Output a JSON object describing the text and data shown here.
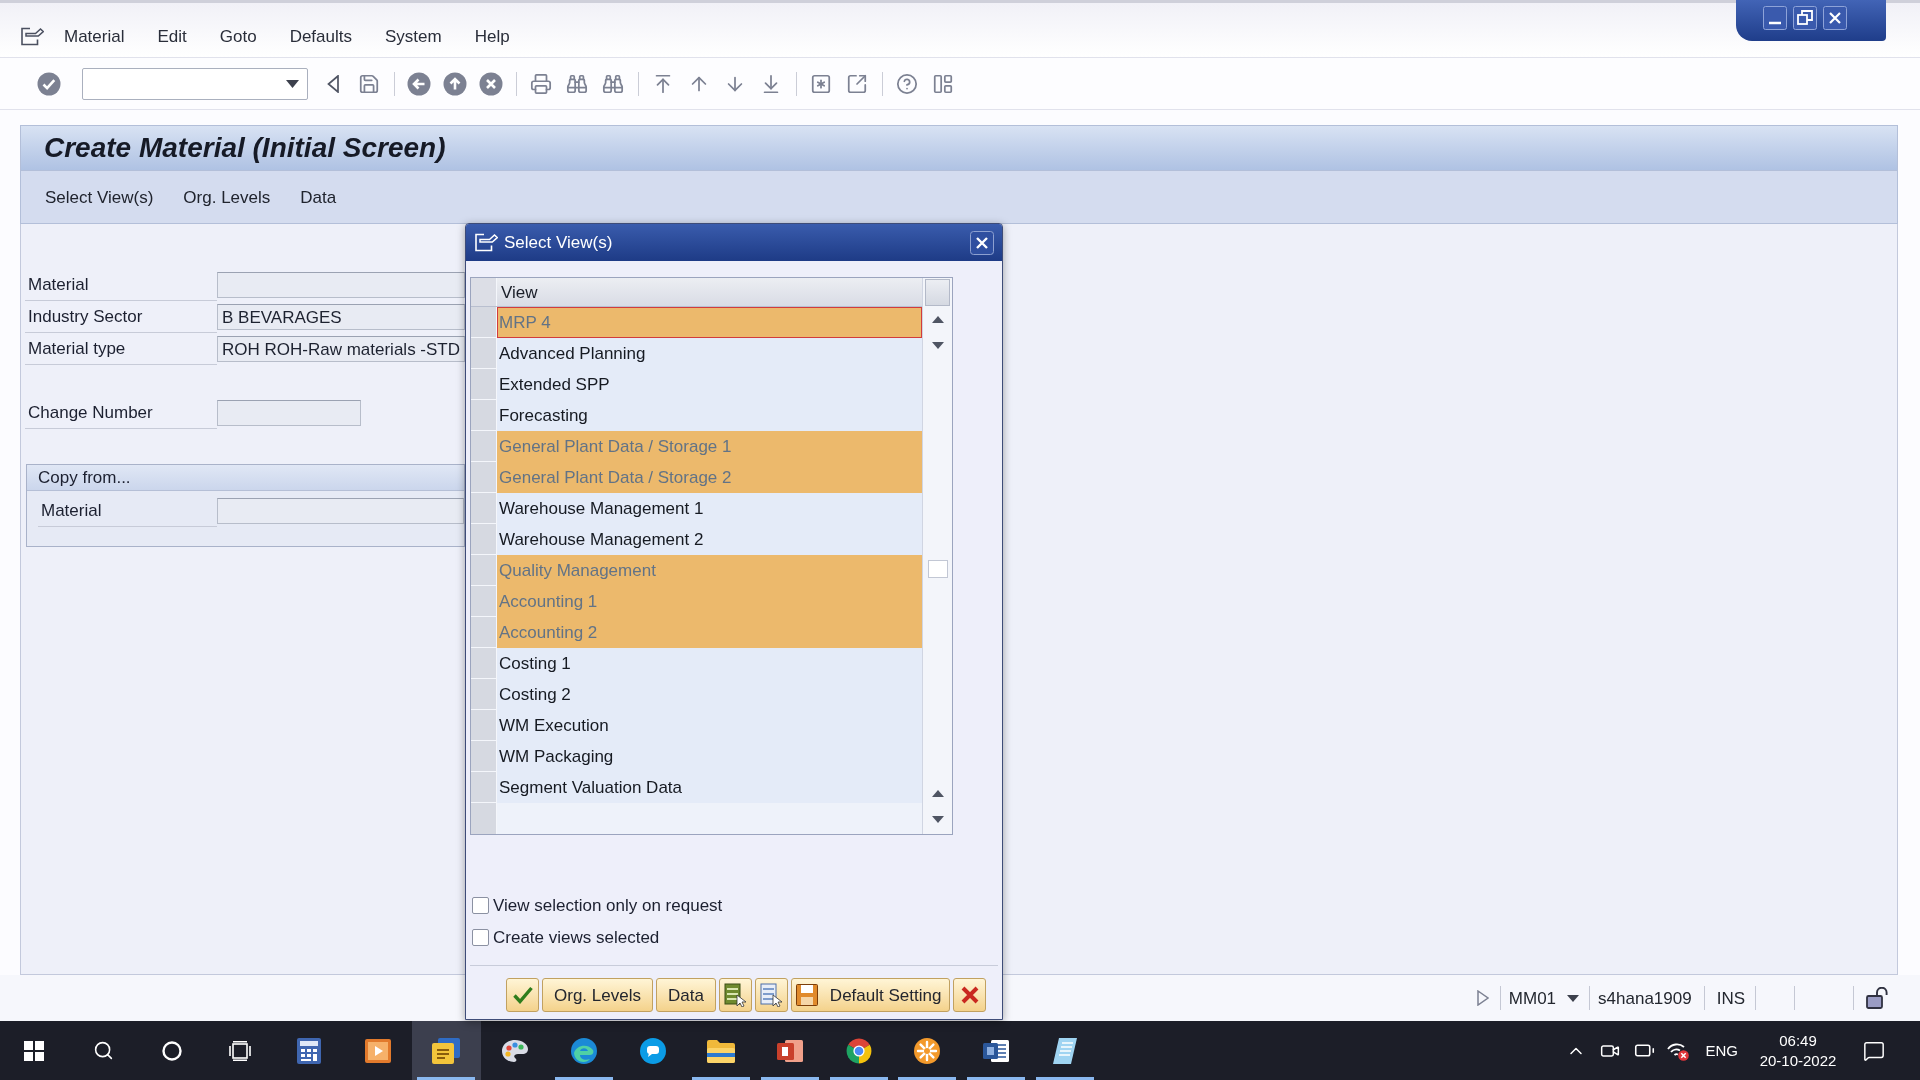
{
  "menu": [
    "Material",
    "Edit",
    "Goto",
    "Defaults",
    "System",
    "Help"
  ],
  "title": "Create Material (Initial Screen)",
  "app_toolbar": [
    "Select View(s)",
    "Org. Levels",
    "Data"
  ],
  "form": {
    "fields": [
      {
        "label": "Material"
      },
      {
        "label": "Industry Sector",
        "value": "B BEVARAGES"
      },
      {
        "label": "Material type",
        "value": "ROH ROH-Raw materials -STD"
      }
    ],
    "change_number": {
      "label": "Change Number"
    },
    "copy_from": {
      "title": "Copy from...",
      "fields": [
        {
          "label": "Material"
        }
      ]
    }
  },
  "dialog": {
    "title": "Select View(s)",
    "table": {
      "columns": [
        "View"
      ],
      "rows": [
        {
          "label": "MRP 4",
          "selected": true,
          "focused": true
        },
        {
          "label": "Advanced Planning",
          "selected": false,
          "focused": false
        },
        {
          "label": "Extended SPP",
          "selected": false,
          "focused": false
        },
        {
          "label": "Forecasting",
          "selected": false,
          "focused": false
        },
        {
          "label": "General Plant Data / Storage 1",
          "selected": true,
          "focused": false
        },
        {
          "label": "General Plant Data / Storage 2",
          "selected": true,
          "focused": false
        },
        {
          "label": "Warehouse Management 1",
          "selected": false,
          "focused": false
        },
        {
          "label": "Warehouse Management 2",
          "selected": false,
          "focused": false
        },
        {
          "label": "Quality Management",
          "selected": true,
          "focused": false
        },
        {
          "label": "Accounting 1",
          "selected": true,
          "focused": false
        },
        {
          "label": "Accounting 2",
          "selected": true,
          "focused": false
        },
        {
          "label": "Costing 1",
          "selected": false,
          "focused": false
        },
        {
          "label": "Costing 2",
          "selected": false,
          "focused": false
        },
        {
          "label": "WM Execution",
          "selected": false,
          "focused": false
        },
        {
          "label": "WM Packaging",
          "selected": false,
          "focused": false
        },
        {
          "label": "Segment Valuation Data",
          "selected": false,
          "focused": false
        }
      ]
    },
    "checkboxes": [
      {
        "label": "View selection only on request",
        "checked": false
      },
      {
        "label": "Create views selected",
        "checked": false
      }
    ],
    "buttons": [
      {
        "kind": "confirm"
      },
      {
        "kind": "text",
        "label": "Org. Levels"
      },
      {
        "kind": "text",
        "label": "Data"
      },
      {
        "kind": "select-all"
      },
      {
        "kind": "deselect-all"
      },
      {
        "kind": "save",
        "label": "Default Setting"
      },
      {
        "kind": "cancel"
      }
    ]
  },
  "status_bar": {
    "transaction": "MM01",
    "system": "s4hana1909",
    "mode": "INS"
  },
  "taskbar": {
    "apps": [
      {
        "kind": "calculator",
        "selected": false,
        "running": false
      },
      {
        "kind": "player",
        "selected": false,
        "running": false
      },
      {
        "kind": "logon",
        "selected": true,
        "running": true
      },
      {
        "kind": "palette",
        "selected": false,
        "running": false
      },
      {
        "kind": "swirl",
        "selected": false,
        "running": true
      },
      {
        "kind": "disc",
        "selected": false,
        "running": false
      },
      {
        "kind": "folder",
        "selected": false,
        "running": true
      },
      {
        "kind": "slides",
        "selected": false,
        "running": true
      },
      {
        "kind": "ring",
        "selected": false,
        "running": true
      },
      {
        "kind": "flower",
        "selected": false,
        "running": true
      },
      {
        "kind": "document",
        "selected": false,
        "running": true
      },
      {
        "kind": "sheet",
        "selected": false,
        "running": true
      }
    ],
    "language": "ENG",
    "time": "06:49",
    "date": "20-10-2022"
  }
}
